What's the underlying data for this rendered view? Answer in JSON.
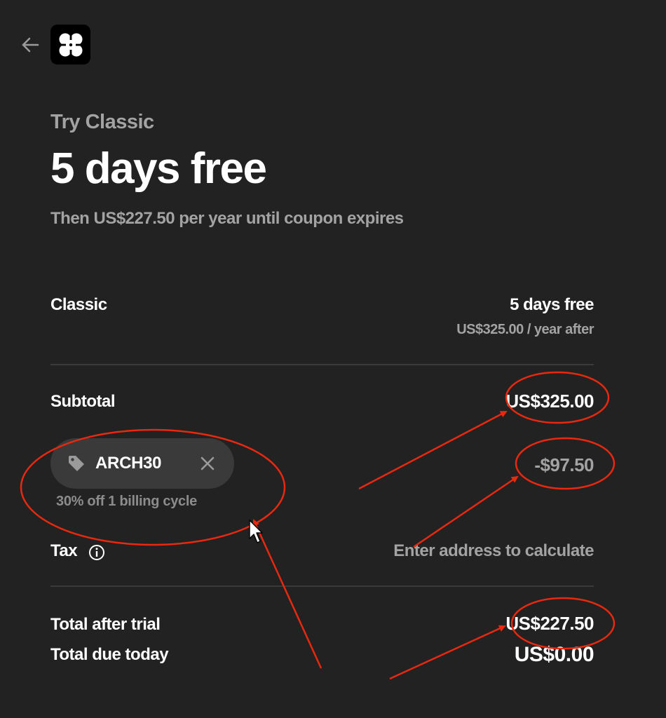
{
  "header": {
    "back_icon": "arrow-left-icon",
    "logo_icon": "four-petal-logo-icon"
  },
  "plan": {
    "eyebrow": "Try Classic",
    "headline": "5 days free",
    "subline": "Then US$227.50 per year until coupon expires"
  },
  "line_item": {
    "name": "Classic",
    "price": "5 days free",
    "price_note": "US$325.00 / year after"
  },
  "subtotal": {
    "label": "Subtotal",
    "value": "US$325.00"
  },
  "coupon": {
    "code": "ARCH30",
    "description": "30% off 1 billing cycle",
    "discount": "-$97.50",
    "tag_icon": "tag-icon",
    "remove_icon": "close-icon"
  },
  "tax": {
    "label": "Tax",
    "value": "Enter address to calculate",
    "info_icon": "info-icon"
  },
  "totals": {
    "after_trial_label": "Total after trial",
    "after_trial_value": "US$227.50",
    "due_today_label": "Total due today",
    "due_today_value": "US$0.00"
  },
  "colors": {
    "background": "#222222",
    "text_primary": "#ffffff",
    "text_muted": "#a3a3a3",
    "chip": "#3a3a3a",
    "annotation": "#e8280f"
  }
}
